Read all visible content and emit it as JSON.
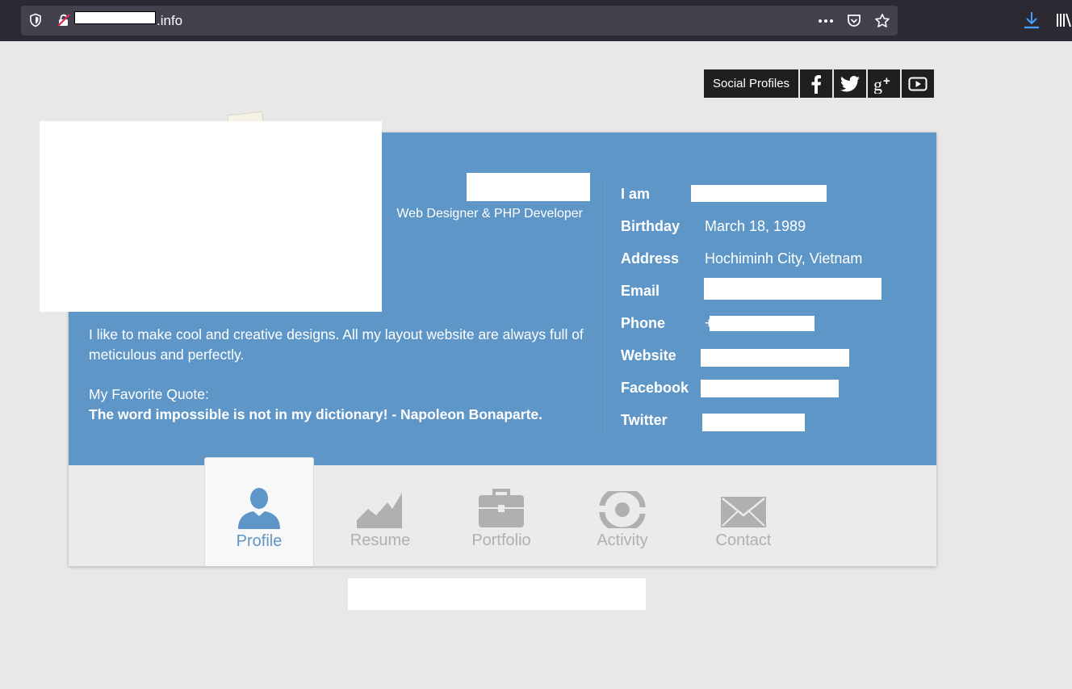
{
  "browser": {
    "url_domain": ".info",
    "icons": [
      "shield-icon",
      "broken-lock-icon",
      "more-icon",
      "pocket-icon",
      "bookmark-star-icon",
      "download-icon",
      "library-icon"
    ]
  },
  "social": {
    "label": "Social Profiles",
    "icons": [
      "facebook-icon",
      "twitter-icon",
      "google-plus-icon",
      "youtube-icon"
    ]
  },
  "profile": {
    "role": "Web Designer & PHP Developer",
    "bio": "I like to make cool and creative designs. All my layout website are always full of meticulous and perfectly.",
    "quote_label": "My Favorite Quote:",
    "quote": "The word impossible is not in my dictionary! - Napoleon Bonaparte."
  },
  "info": [
    {
      "key": "I am",
      "value": ""
    },
    {
      "key": "Birthday",
      "value": "March 18, 1989"
    },
    {
      "key": "Address",
      "value": "Hochiminh City, Vietnam"
    },
    {
      "key": "Email",
      "value": ""
    },
    {
      "key": "Phone",
      "value": "+"
    },
    {
      "key": "Website",
      "value": ""
    },
    {
      "key": "Facebook",
      "value": ""
    },
    {
      "key": "Twitter",
      "value": ""
    }
  ],
  "tabs": [
    {
      "label": "Profile",
      "icon": "user-icon",
      "active": true
    },
    {
      "label": "Resume",
      "icon": "chart-icon",
      "active": false
    },
    {
      "label": "Portfolio",
      "icon": "briefcase-icon",
      "active": false
    },
    {
      "label": "Activity",
      "icon": "activity-icon",
      "active": false
    },
    {
      "label": "Contact",
      "icon": "envelope-icon",
      "active": false
    }
  ],
  "colors": {
    "accent": "#5e96c8",
    "tab_inactive": "#b0b0b0",
    "page_bg": "#e8e8e8"
  }
}
